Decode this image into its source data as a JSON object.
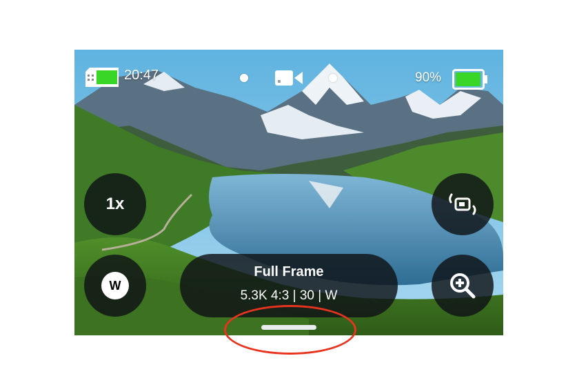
{
  "status_bar": {
    "time": "20:47",
    "battery_percent": "90%",
    "battery_level": 0.9,
    "mode_icon": "video-camera-icon"
  },
  "controls": {
    "zoom_label": "1x",
    "lens_badge": "W",
    "mode_title": "Full Frame",
    "mode_settings": "5.3K 4:3 | 30 | W",
    "front_screen_icon": "front-screen-toggle-icon",
    "zoom_icon": "zoom-in-icon"
  },
  "colors": {
    "battery_fill": "#39d627",
    "button_bg": "#0f1216",
    "annotation_circle": "#e8331f"
  }
}
